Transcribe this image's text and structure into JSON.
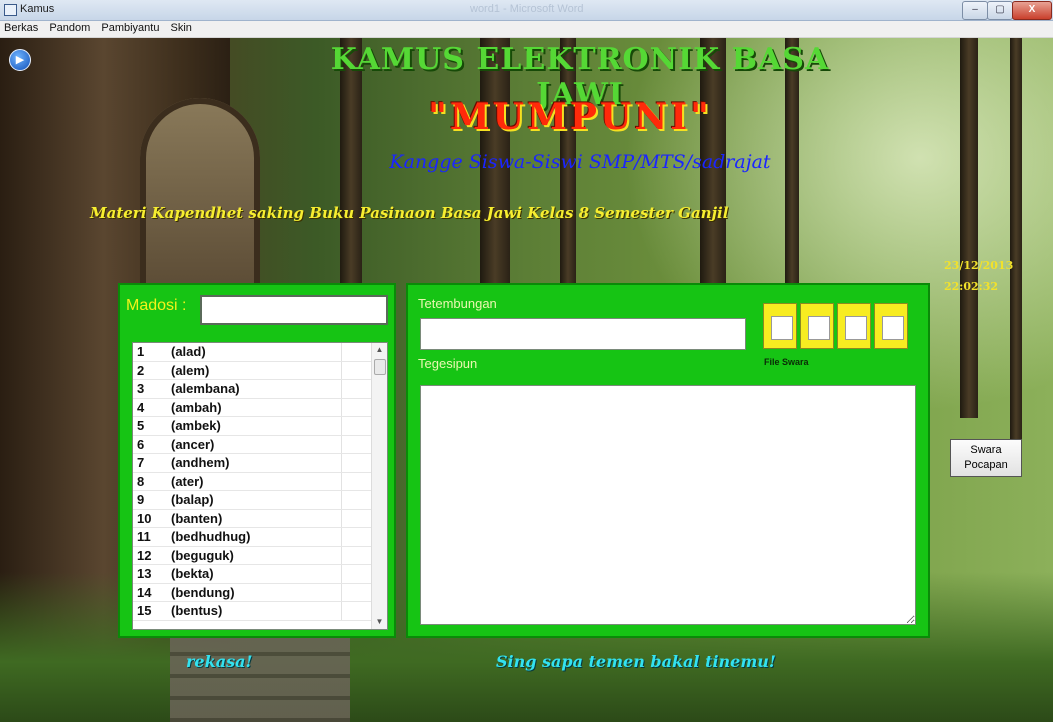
{
  "window": {
    "title": "Kamus",
    "ghost_title": "word1 - Microsoft Word",
    "min": "–",
    "max": "▢",
    "close": "X"
  },
  "menu": [
    "Berkas",
    "Pandom",
    "Pambiyantu",
    "Skin"
  ],
  "header": {
    "title1": "KAMUS ELEKTRONIK BASA JAWI",
    "title2": "\"MUMPUNI\"",
    "title3": "Kangge Siswa-Siswi SMP/MTS/sadrajat",
    "subtitle": "Materi Kapendhet saking Buku Pasinaon Basa Jawi Kelas 8 Semester Ganjil"
  },
  "search": {
    "label": "Madosi :",
    "value": ""
  },
  "word_list": [
    {
      "num": "1",
      "word": "(alad)"
    },
    {
      "num": "2",
      "word": "(alem)"
    },
    {
      "num": "3",
      "word": "(alembana)"
    },
    {
      "num": "4",
      "word": "(ambah)"
    },
    {
      "num": "5",
      "word": "(ambek)"
    },
    {
      "num": "6",
      "word": "(ancer)"
    },
    {
      "num": "7",
      "word": "(andhem)"
    },
    {
      "num": "8",
      "word": "(ater)"
    },
    {
      "num": "9",
      "word": "(balap)"
    },
    {
      "num": "10",
      "word": "(banten)"
    },
    {
      "num": "11",
      "word": "(bedhudhug)"
    },
    {
      "num": "12",
      "word": "(beguguk)"
    },
    {
      "num": "13",
      "word": "(bekta)"
    },
    {
      "num": "14",
      "word": "(bendung)"
    },
    {
      "num": "15",
      "word": "(bentus)"
    }
  ],
  "detail": {
    "tetembungan_label": "Tetembungan",
    "tetembungan_value": "",
    "tegesipun_label": "Tegesipun",
    "tegesipun_value": "",
    "file_swara_label": "File Swara",
    "icons": [
      "open-file-icon",
      "save-file-icon",
      "record-icon",
      "clear-icon"
    ]
  },
  "clock": {
    "date": "23/12/2013",
    "time": "22:02:32"
  },
  "swara_button": {
    "line1": "Swara",
    "line2": "Pocapan"
  },
  "footer": {
    "left": "rekasa!",
    "right": "Sing sapa temen bakal tinemu!"
  },
  "colors": {
    "panel": "#16c414",
    "title_green": "#55d835",
    "title_red": "#ff2a0a",
    "subtitle_yellow": "#f7ee30",
    "footer_cyan": "#33e2f0"
  }
}
